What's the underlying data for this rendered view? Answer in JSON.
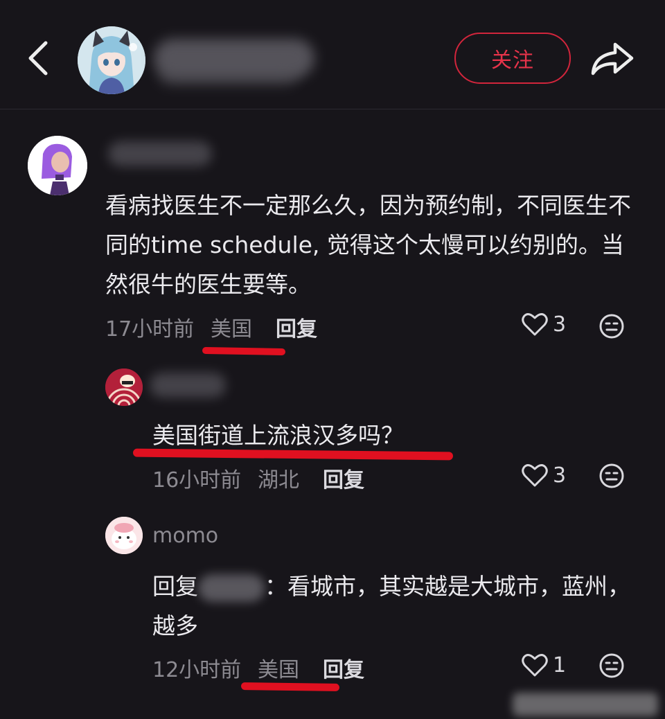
{
  "header": {
    "follow_label": "关注"
  },
  "comments": [
    {
      "text": "看病找医生不一定那么久，因为预约制，不同医生不同的time schedule, 觉得这个太慢可以约别的。当然很牛的医生要等。",
      "time": "17小时前",
      "location": "美国",
      "reply_label": "回复",
      "likes": "3"
    },
    {
      "text": "美国街道上流浪汉多吗？",
      "time": "16小时前",
      "location": "湖北",
      "reply_label": "回复",
      "likes": "3"
    },
    {
      "username": "momo",
      "reply_prefix": "回复",
      "reply_suffix_char": "：",
      "text": "看城市，其实越是大城市，蓝州，越多",
      "time": "12小时前",
      "location": "美国",
      "reply_label": "回复",
      "likes": "1"
    }
  ],
  "icons": {
    "back": "chevron-left-icon",
    "share": "share-arrow-icon",
    "like": "heart-outline-icon",
    "emoji": "neutral-face-icon"
  },
  "colors": {
    "accent": "#e6334a",
    "background": "#17151a",
    "highlight": "#e01020"
  }
}
